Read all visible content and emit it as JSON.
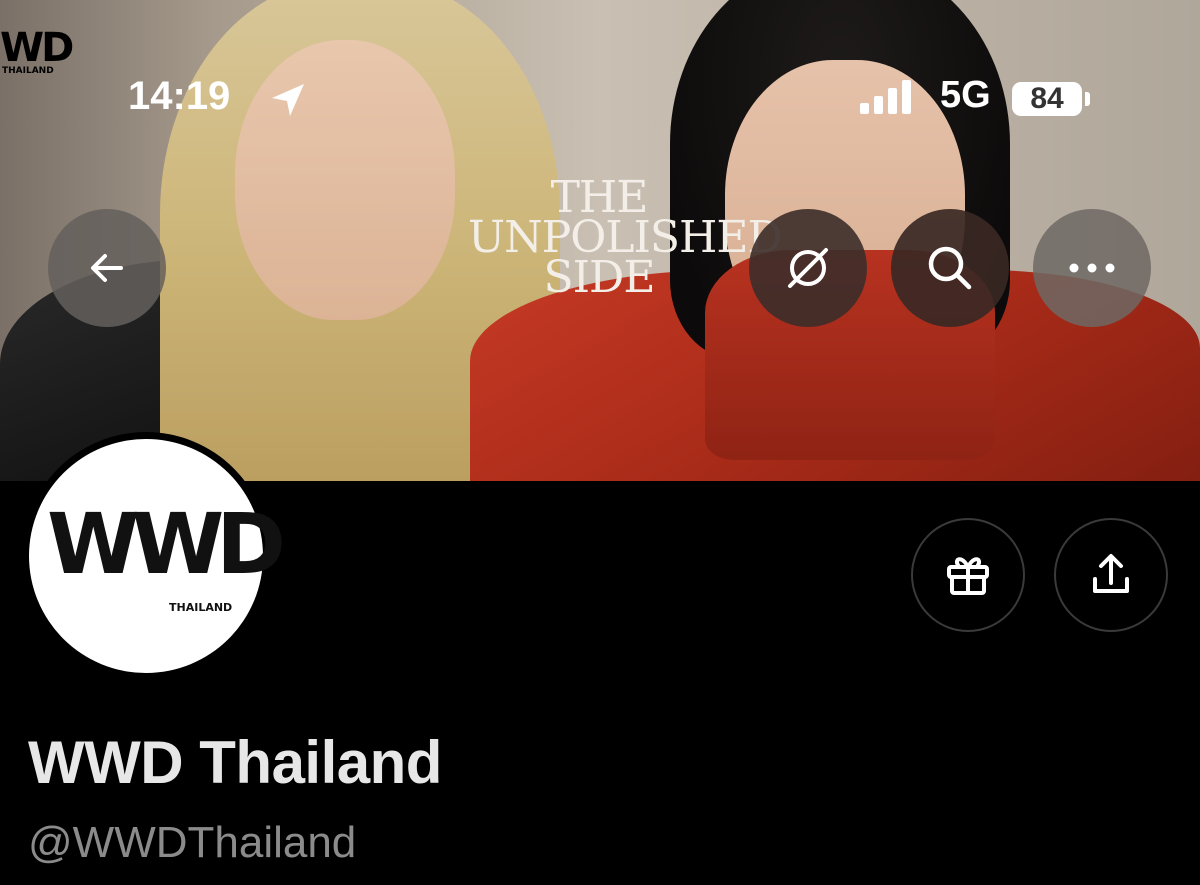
{
  "status_bar": {
    "time": "14:19",
    "network": "5G",
    "battery": "84",
    "location_icon": "location-arrow-icon",
    "signal_icon": "signal-bars-icon"
  },
  "banner": {
    "title_line1": "THE",
    "title_line2": "UNPOLISHED",
    "title_line3": "SIDE",
    "corner_logo": "WD",
    "corner_logo_sub": "THAILAND"
  },
  "nav": {
    "back_icon": "arrow-left-icon",
    "grok_icon": "grok-icon",
    "search_icon": "search-icon",
    "more_icon": "more-dots-icon"
  },
  "profile": {
    "avatar_logo": "WWD",
    "avatar_logo_sub": "THAILAND",
    "display_name": "WWD Thailand",
    "handle": "@WWDThailand"
  },
  "actions": {
    "gift_icon": "gift-icon",
    "share_icon": "share-icon"
  },
  "colors": {
    "background": "#000000",
    "name": "#e7e7e7",
    "handle": "#8b8b8b",
    "button_border": "#3a3a3a"
  }
}
